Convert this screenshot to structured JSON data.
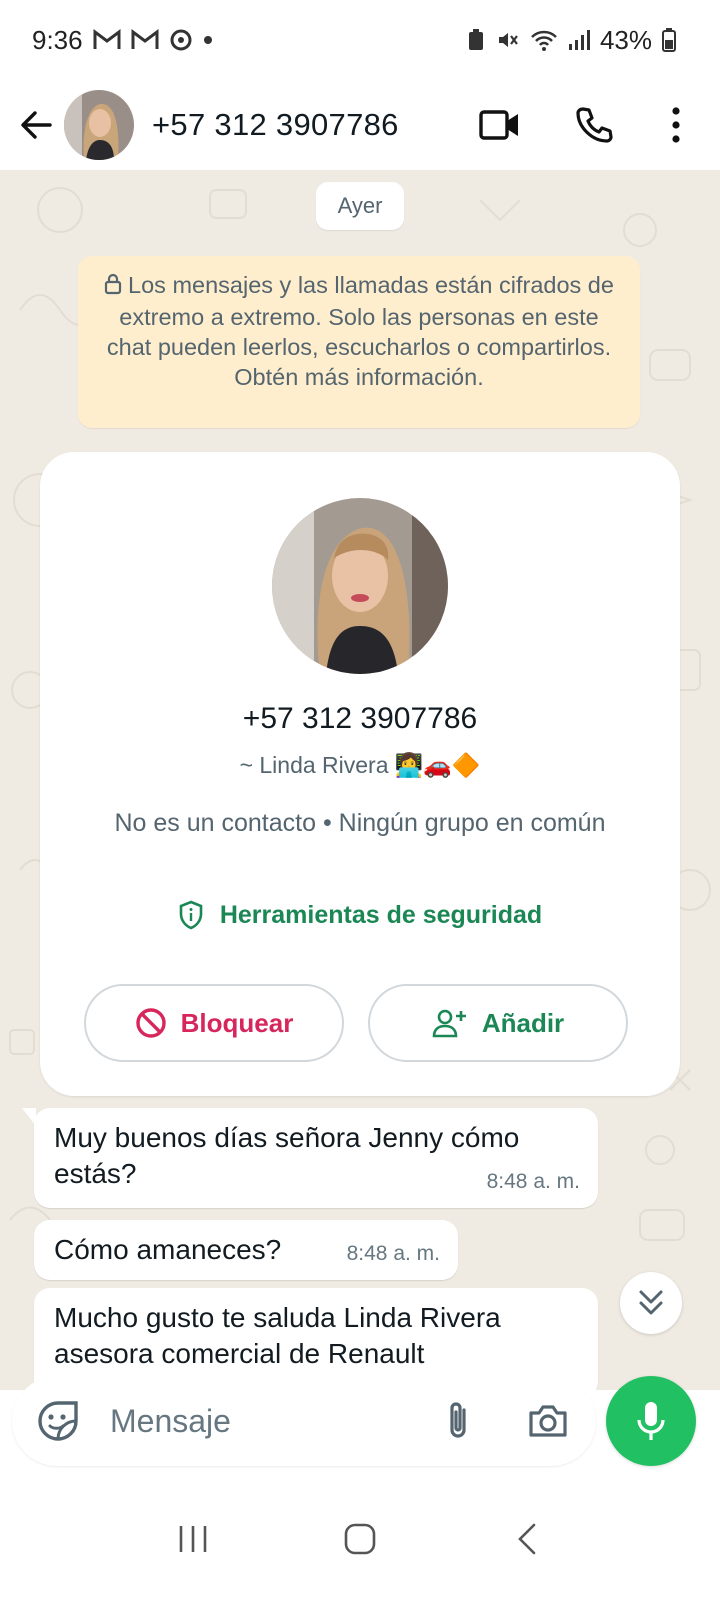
{
  "status_bar": {
    "time": "9:36",
    "battery": "43%",
    "icons": [
      "gmail-icon",
      "gmail-icon",
      "sync-icon",
      "dot-icon",
      "battery-saver-icon",
      "mute-icon",
      "wifi-icon",
      "signal-icon",
      "battery-icon"
    ]
  },
  "header": {
    "title": "+57 312 3907786",
    "icons": [
      "back-arrow-icon",
      "avatar",
      "video-call-icon",
      "phone-icon",
      "more-vert-icon"
    ]
  },
  "chat": {
    "date_chip": "Ayer",
    "encryption_notice": "Los mensajes y las llamadas están cifrados de extremo a extremo. Solo las personas en este chat pueden leerlos, escucharlos o compartirlos. Obtén más información.",
    "contact_card": {
      "phone": "+57 312 3907786",
      "name": "~ Linda Rivera",
      "name_emoji": "👩‍💻🚗🔶",
      "meta": "No es un contacto • Ningún grupo en común",
      "security_tools": "Herramientas de seguridad",
      "block_label": "Bloquear",
      "add_label": "Añadir"
    },
    "messages": [
      {
        "text": "Muy buenos días señora Jenny cómo estás?",
        "time": "8:48 a. m."
      },
      {
        "text": "Cómo amaneces?",
        "time": "8:48 a. m."
      },
      {
        "text": "Mucho gusto te saluda Linda Rivera asesora comercial de Renault",
        "time": ""
      }
    ]
  },
  "composer": {
    "placeholder": "Mensaje"
  },
  "colors": {
    "accent_green": "#1b8755",
    "mic_green": "#21c063",
    "block_red": "#d7265b",
    "chat_bg": "#efeae2",
    "notice_bg": "#ffeecd"
  }
}
